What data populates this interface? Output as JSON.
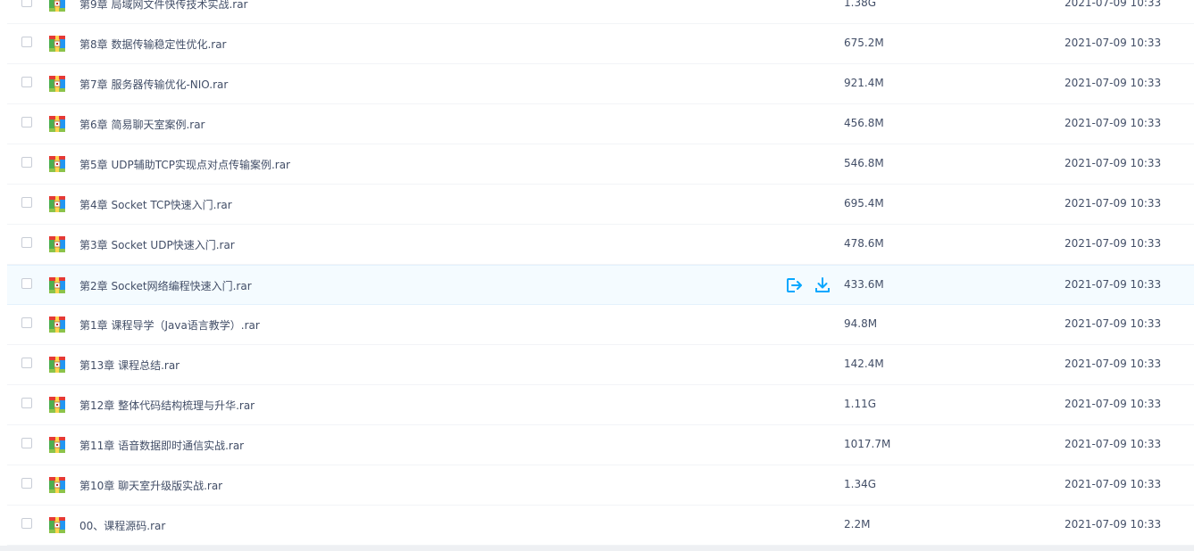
{
  "files": [
    {
      "name": "第9章 局域网文件快传技术实战.rar",
      "size": "1.38G",
      "time": "2021-07-09 10:33"
    },
    {
      "name": "第8章 数据传输稳定性优化.rar",
      "size": "675.2M",
      "time": "2021-07-09 10:33"
    },
    {
      "name": "第7章 服务器传输优化-NIO.rar",
      "size": "921.4M",
      "time": "2021-07-09 10:33"
    },
    {
      "name": "第6章 简易聊天室案例.rar",
      "size": "456.8M",
      "time": "2021-07-09 10:33"
    },
    {
      "name": "第5章 UDP辅助TCP实现点对点传输案例.rar",
      "size": "546.8M",
      "time": "2021-07-09 10:33"
    },
    {
      "name": "第4章 Socket TCP快速入门.rar",
      "size": "695.4M",
      "time": "2021-07-09 10:33"
    },
    {
      "name": "第3章 Socket UDP快速入门.rar",
      "size": "478.6M",
      "time": "2021-07-09 10:33"
    },
    {
      "name": "第2章 Socket网络编程快速入门.rar",
      "size": "433.6M",
      "time": "2021-07-09 10:33"
    },
    {
      "name": "第1章 课程导学（Java语言教学）.rar",
      "size": "94.8M",
      "time": "2021-07-09 10:33"
    },
    {
      "name": "第13章 课程总结.rar",
      "size": "142.4M",
      "time": "2021-07-09 10:33"
    },
    {
      "name": "第12章 整体代码结构梳理与升华.rar",
      "size": "1.11G",
      "time": "2021-07-09 10:33"
    },
    {
      "name": "第11章 语音数据即时通信实战.rar",
      "size": "1017.7M",
      "time": "2021-07-09 10:33"
    },
    {
      "name": "第10章 聊天室升级版实战.rar",
      "size": "1.34G",
      "time": "2021-07-09 10:33"
    },
    {
      "name": "00、课程源码.rar",
      "size": "2.2M",
      "time": "2021-07-09 10:33"
    }
  ],
  "hover_row_index": 7,
  "icons": {
    "file": "archive-icon",
    "share": "share-icon",
    "download": "download-icon"
  },
  "colors": {
    "accent": "#06a7ff",
    "hover_bg": "#f4fbff",
    "text": "#424e67"
  }
}
